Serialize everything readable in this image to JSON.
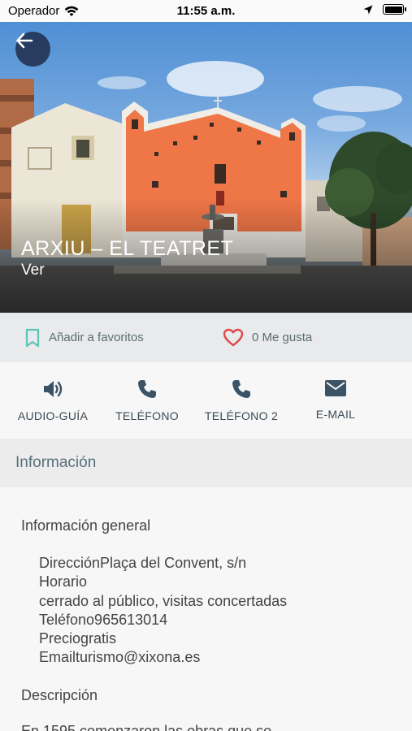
{
  "status_bar": {
    "carrier": "Operador",
    "time": "11:55 a.m."
  },
  "hero": {
    "title": "ARXIU – EL TEATRET",
    "subtitle": "Ver",
    "back_icon": "arrow-left-icon"
  },
  "favorites": {
    "add_label": "Añadir a favoritos",
    "likes_label": "0 Me gusta",
    "bookmark_color": "#5ec4b6",
    "heart_color": "#e0484a"
  },
  "actions": [
    {
      "label": "AUDIO-GUÍA",
      "icon": "speaker-icon"
    },
    {
      "label": "TELÉFONO",
      "icon": "phone-icon"
    },
    {
      "label": "TELÉFONO 2",
      "icon": "phone-icon"
    },
    {
      "label": "E-MAIL",
      "icon": "mail-icon"
    }
  ],
  "info_header": "Información",
  "general": {
    "title": "Información general",
    "lines": [
      "DirecciónPlaça del Convent, s/n",
      "Horario",
      "cerrado al público, visitas concertadas",
      "Teléfono965613014",
      "Preciogratis",
      "Emailturismo@xixona.es"
    ]
  },
  "description": {
    "title": "Descripción",
    "text": "En 1595 comenzaron las obras que se"
  },
  "colors": {
    "accent_icon": "#3b5366",
    "header_text": "#56707a"
  }
}
